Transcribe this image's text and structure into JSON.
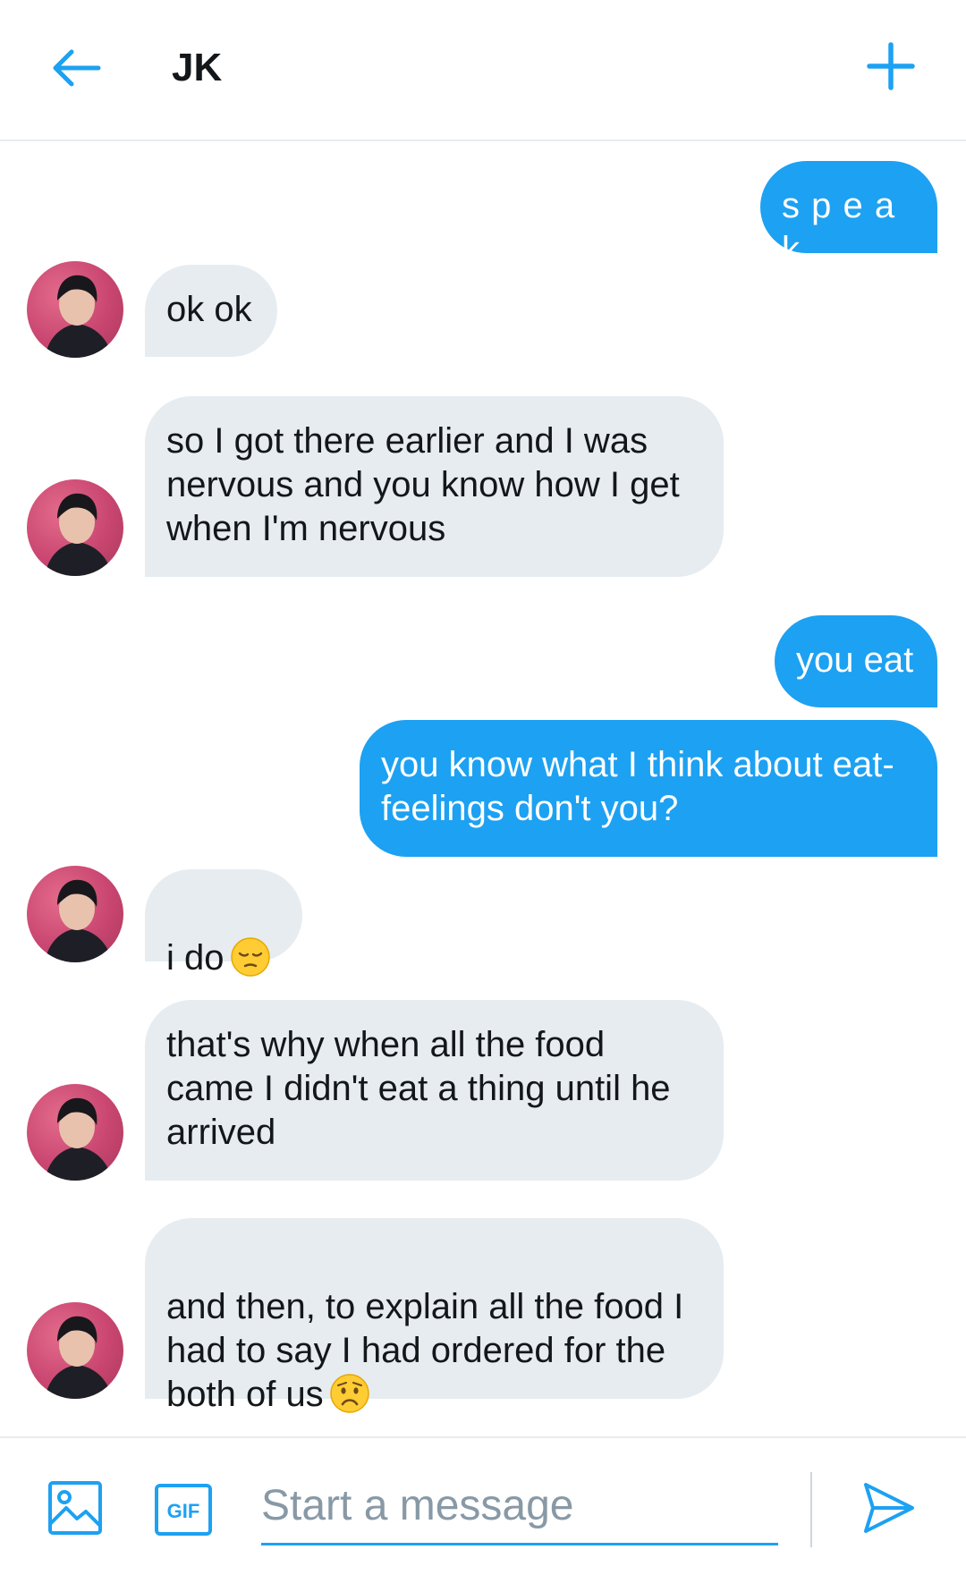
{
  "header": {
    "title": "JK",
    "back_icon": "arrow-left-icon",
    "action_icon": "plus-icon",
    "accent_color": "#1da1f2"
  },
  "messages": [
    {
      "sender": "me",
      "text": "s p e a k"
    },
    {
      "sender": "other",
      "text": "ok ok"
    },
    {
      "sender": "other",
      "text": "so I got there earlier and I was nervous and you know how I get when I'm nervous"
    },
    {
      "sender": "me",
      "text": "you eat"
    },
    {
      "sender": "me",
      "text": "you know what I think about eat-feelings don't you?"
    },
    {
      "sender": "other",
      "text": "i do",
      "emoji": "pensive-face"
    },
    {
      "sender": "other",
      "text": "that's why when all the food came I didn't eat a thing until he arrived"
    },
    {
      "sender": "other",
      "text": "and then, to explain all the food I had to say I had ordered for the both of us",
      "emoji": "worried-face"
    }
  ],
  "composer": {
    "placeholder": "Start a message",
    "gif_label": "GIF",
    "media_icon": "image-icon",
    "send_icon": "send-icon"
  },
  "colors": {
    "sent_bubble": "#1da1f2",
    "received_bubble": "#e6ecf0",
    "avatar_background": "#c94671"
  }
}
